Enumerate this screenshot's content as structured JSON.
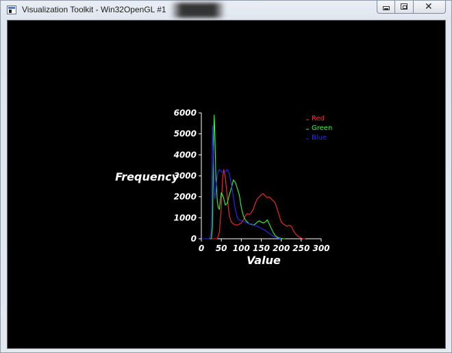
{
  "window": {
    "title": "Visualization Toolkit - Win32OpenGL #1",
    "buttons": {
      "minimize": "minimize",
      "maximize": "maximize",
      "close": "close"
    }
  },
  "colors": {
    "background": "#000000",
    "axes": "#ffffff",
    "red": "#ff2a2a",
    "green": "#33ff33",
    "blue": "#2a2aff"
  },
  "chart_data": {
    "type": "line",
    "title": "",
    "xlabel": "Value",
    "ylabel": "Frequency",
    "xlim": [
      0,
      300
    ],
    "ylim": [
      0,
      6000
    ],
    "xticks": [
      "0",
      "50",
      "100",
      "150",
      "200",
      "250",
      "300"
    ],
    "yticks": [
      "0",
      "1000",
      "2000",
      "3000",
      "4000",
      "5000",
      "6000"
    ],
    "legend_position": "top-right",
    "grid": false,
    "series": [
      {
        "name": "Red",
        "color": "#ff2a2a",
        "x": [
          0,
          40,
          45,
          50,
          53,
          56,
          60,
          65,
          70,
          75,
          80,
          90,
          100,
          105,
          110,
          115,
          120,
          125,
          130,
          135,
          140,
          145,
          150,
          155,
          160,
          165,
          170,
          175,
          180,
          185,
          190,
          195,
          200,
          205,
          210,
          215,
          220,
          225,
          230,
          235,
          240,
          245,
          250,
          255,
          260
        ],
        "y": [
          0,
          0,
          300,
          1500,
          2800,
          3300,
          2900,
          2000,
          1100,
          800,
          700,
          650,
          750,
          900,
          1100,
          1200,
          1150,
          1250,
          1400,
          1700,
          1900,
          2000,
          2100,
          2150,
          2050,
          1950,
          2000,
          1900,
          1800,
          1700,
          1400,
          1100,
          800,
          700,
          650,
          600,
          650,
          600,
          400,
          250,
          150,
          80,
          30,
          0,
          0
        ]
      },
      {
        "name": "Green",
        "color": "#33ff33",
        "x": [
          0,
          25,
          28,
          30,
          32,
          34,
          36,
          38,
          40,
          42,
          45,
          50,
          55,
          60,
          65,
          70,
          75,
          80,
          85,
          90,
          95,
          100,
          105,
          110,
          115,
          120,
          125,
          130,
          135,
          140,
          145,
          150,
          155,
          160,
          165,
          170,
          175,
          180,
          185,
          190,
          195,
          200,
          205,
          210
        ],
        "y": [
          0,
          0,
          600,
          3600,
          5900,
          5000,
          3200,
          2400,
          1800,
          1500,
          1400,
          2200,
          2000,
          1600,
          1700,
          2100,
          2400,
          2800,
          2700,
          2400,
          2100,
          1500,
          1100,
          900,
          800,
          700,
          700,
          650,
          700,
          800,
          850,
          800,
          750,
          800,
          900,
          700,
          500,
          300,
          150,
          80,
          40,
          20,
          0,
          0
        ]
      },
      {
        "name": "Blue",
        "color": "#2a2aff",
        "x": [
          0,
          20,
          24,
          26,
          28,
          30,
          32,
          34,
          36,
          38,
          40,
          42,
          45,
          50,
          55,
          60,
          65,
          70,
          75,
          80,
          85,
          90,
          95,
          100,
          110,
          120,
          130,
          140,
          150,
          160,
          170,
          180,
          190,
          200
        ],
        "y": [
          0,
          0,
          200,
          1500,
          5400,
          4200,
          2500,
          1900,
          2300,
          2700,
          3000,
          3200,
          3300,
          3200,
          3150,
          3200,
          3300,
          3100,
          2600,
          2000,
          1400,
          1000,
          900,
          850,
          800,
          700,
          650,
          600,
          500,
          400,
          250,
          120,
          40,
          0
        ]
      }
    ]
  }
}
